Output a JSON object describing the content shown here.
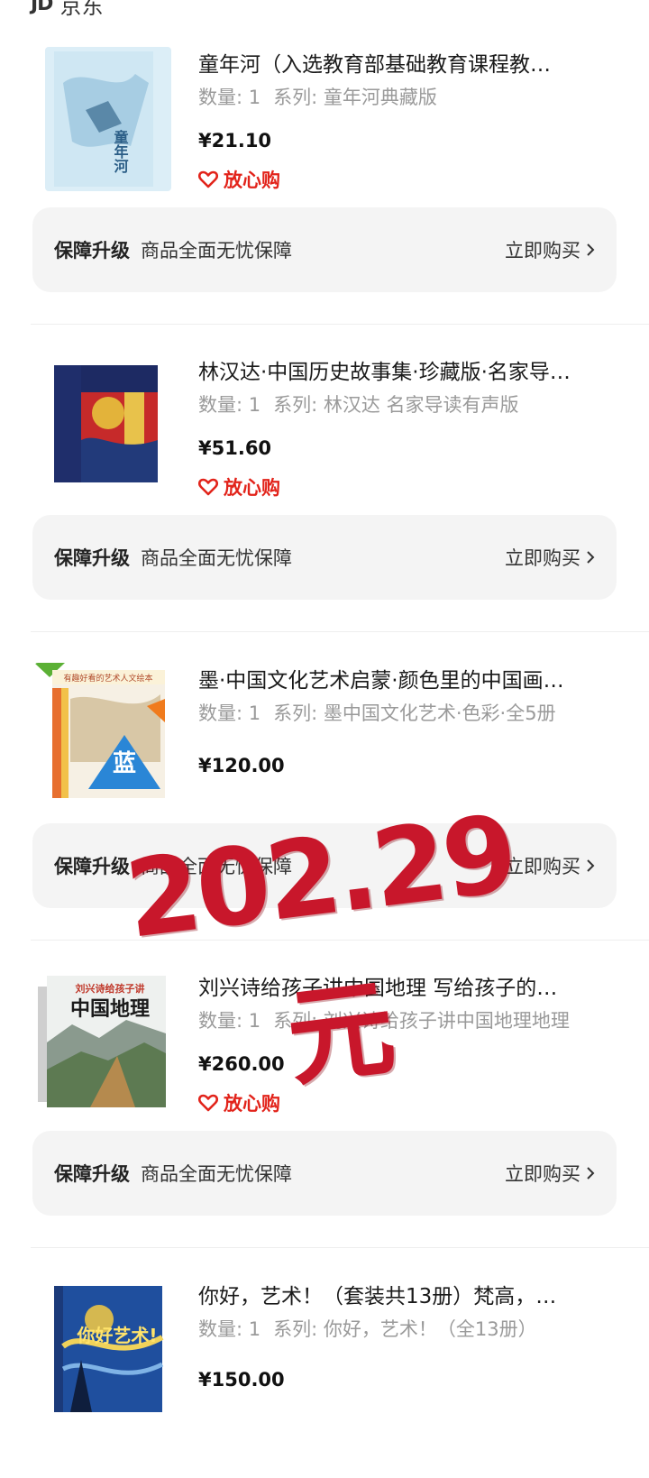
{
  "store": {
    "logo": "JD",
    "name": "京东"
  },
  "common": {
    "qty_label": "数量: 1",
    "series_prefix": "系列: ",
    "assure_label": "放心购",
    "guard_title": "保障升级",
    "guard_desc": "商品全面无忧保障",
    "guard_buy": "立即购买"
  },
  "items": [
    {
      "title": "童年河（入选教育部基础教育课程教…",
      "series": "系列: 童年河典藏版",
      "price": "¥21.10",
      "has_assure": true,
      "cover_icon": "book-cover-image"
    },
    {
      "title": "林汉达·中国历史故事集·珍藏版·名家导…",
      "series": "系列: 林汉达 名家导读有声版",
      "price": "¥51.60",
      "has_assure": true,
      "cover_icon": "book-cover-image"
    },
    {
      "title": "墨·中国文化艺术启蒙·颜色里的中国画…",
      "series": "系列: 墨中国文化艺术·色彩·全5册",
      "price": "¥120.00",
      "has_assure": false,
      "cover_icon": "book-cover-image"
    },
    {
      "title": "刘兴诗给孩子讲中国地理 写给孩子的…",
      "series": "系列: 刘兴诗给孩子讲中国地理地理",
      "price": "¥260.00",
      "has_assure": true,
      "cover_icon": "book-cover-image"
    },
    {
      "title": "你好，艺术！（套装共13册）梵高，…",
      "series": "系列: 你好，艺术！（全13册）",
      "price": "¥150.00",
      "has_assure": false,
      "cover_icon": "book-cover-image"
    }
  ],
  "cover_texts": {
    "c1": "童年河",
    "c3_banner": "有趣好看的艺术人文绘本",
    "c3_char": "蓝",
    "c4_series": "刘兴诗给孩子讲",
    "c4_title": "中国地理",
    "c5_title": "你好艺术!"
  },
  "stamp": {
    "text": "202.29元"
  },
  "colors": {
    "accent_red": "#e2231a",
    "stamp_red": "#c8172b",
    "guard_bg": "#f4f4f4"
  }
}
